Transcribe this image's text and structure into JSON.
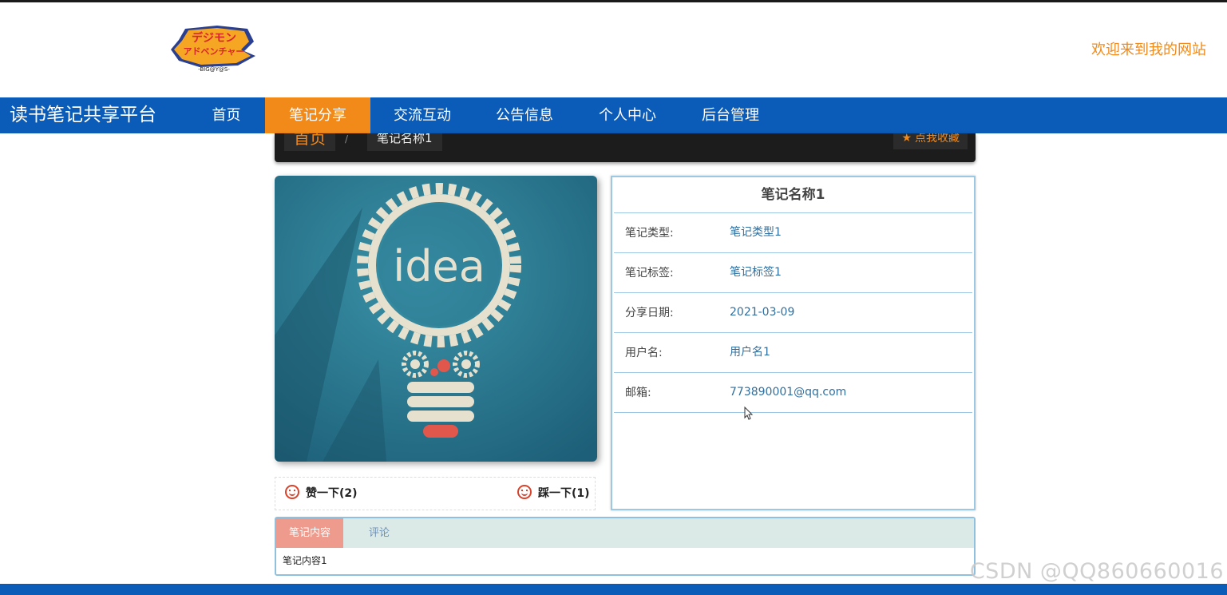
{
  "header": {
    "logo_icon": "digimon-adventure-logo",
    "logo_text_top": "デジモン",
    "logo_text_mid": "アドベンチャー",
    "logo_text_bottom": "-BIG@Y@S-",
    "welcome": "欢迎来到我的网站"
  },
  "nav": {
    "brand": "读书笔记共享平台",
    "items": [
      {
        "label": "首页",
        "active": false
      },
      {
        "label": "笔记分享",
        "active": true
      },
      {
        "label": "交流互动",
        "active": false
      },
      {
        "label": "公告信息",
        "active": false
      },
      {
        "label": "个人中心",
        "active": false
      },
      {
        "label": "后台管理",
        "active": false
      }
    ]
  },
  "breadcrumb": {
    "home": "首页",
    "separator": "/",
    "current": "笔记名称1",
    "favorite_icon": "star-icon",
    "favorite": "点我收藏"
  },
  "cover": {
    "image": "idea-lightbulb-gear-illustration",
    "word": "idea"
  },
  "votes": {
    "like_label": "赞一下",
    "like_count": "(2)",
    "dislike_label": "踩一下",
    "dislike_count": "(1)",
    "icon": "smiley-face-icon"
  },
  "info": {
    "title": "笔记名称1",
    "rows": [
      {
        "label": "笔记类型:",
        "value": "笔记类型1"
      },
      {
        "label": "笔记标签:",
        "value": "笔记标签1"
      },
      {
        "label": "分享日期:",
        "value": "2021-03-09"
      },
      {
        "label": "用户名:",
        "value": "用户名1"
      },
      {
        "label": "邮箱:",
        "value": "773890001@qq.com"
      }
    ]
  },
  "tabs": {
    "items": [
      "笔记内容",
      "评论"
    ],
    "active": "笔记内容",
    "content": "笔记内容1"
  },
  "watermark": "CSDN @QQ860660016",
  "colors": {
    "nav_bg": "#0a5cb8",
    "nav_active": "#f28a1a",
    "welcome": "#f08a1c",
    "panel_border": "#9cc8e4",
    "value_text": "#2f6f9f"
  }
}
